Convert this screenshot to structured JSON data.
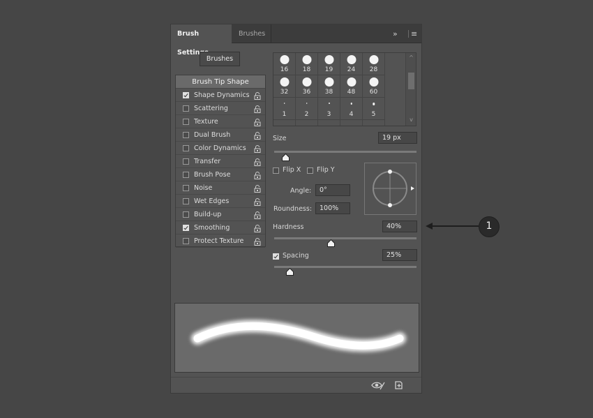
{
  "tabs": {
    "active": "Brush Settings",
    "inactive": "Brushes"
  },
  "header_controls": {
    "collapse": "»",
    "menu": "≡"
  },
  "brushes_button": "Brushes",
  "options": [
    {
      "label": "Brush Tip Shape",
      "header": true
    },
    {
      "label": "Shape Dynamics",
      "checked": true
    },
    {
      "label": "Scattering",
      "checked": false
    },
    {
      "label": "Texture",
      "checked": false
    },
    {
      "label": "Dual Brush",
      "checked": false
    },
    {
      "label": "Color Dynamics",
      "checked": false
    },
    {
      "label": "Transfer",
      "checked": false
    },
    {
      "label": "Brush Pose",
      "checked": false
    },
    {
      "label": "Noise",
      "checked": false
    },
    {
      "label": "Wet Edges",
      "checked": false
    },
    {
      "label": "Build-up",
      "checked": false
    },
    {
      "label": "Smoothing",
      "checked": true
    },
    {
      "label": "Protect Texture",
      "checked": false
    }
  ],
  "brush_presets": [
    [
      "16",
      "18",
      "19",
      "24",
      "28"
    ],
    [
      "32",
      "36",
      "38",
      "48",
      "60"
    ],
    [
      "1",
      "2",
      "3",
      "4",
      "5"
    ]
  ],
  "size": {
    "label": "Size",
    "value": "19 px",
    "slider_fraction": 0.08
  },
  "flip_x": {
    "label": "Flip X",
    "checked": false
  },
  "flip_y": {
    "label": "Flip Y",
    "checked": false
  },
  "angle": {
    "label": "Angle:",
    "value": "0°"
  },
  "roundness": {
    "label": "Roundness:",
    "value": "100%"
  },
  "hardness": {
    "label": "Hardness",
    "value": "40%",
    "slider_fraction": 0.4
  },
  "spacing": {
    "label": "Spacing",
    "value": "25%",
    "checked": true,
    "slider_fraction": 0.11
  },
  "callout": {
    "number": "1"
  }
}
